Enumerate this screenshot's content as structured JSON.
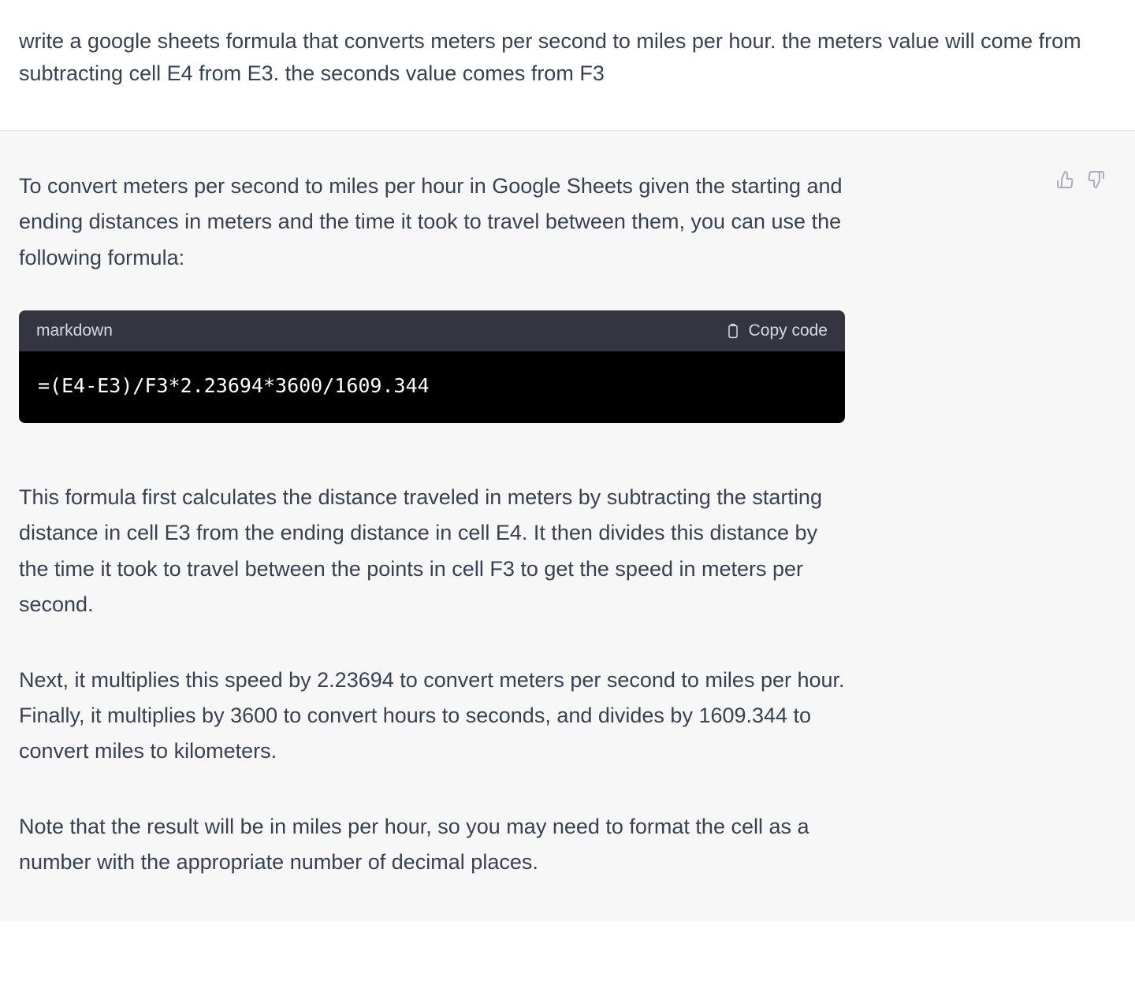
{
  "user": {
    "prompt": "write a google sheets formula that converts meters per second to miles per hour. the meters value will come from subtracting cell E4 from E3. the seconds value comes from F3"
  },
  "assistant": {
    "intro": "To convert meters per second to miles per hour in Google Sheets given the starting and ending distances in meters and the time it took to travel between them, you can use the following formula:",
    "code": {
      "language": "markdown",
      "copy_label": "Copy code",
      "content": "=(E4-E3)/F3*2.23694*3600/1609.344"
    },
    "body1": "This formula first calculates the distance traveled in meters by subtracting the starting distance in cell E3 from the ending distance in cell E4. It then divides this distance by the time it took to travel between the points in cell F3 to get the speed in meters per second.",
    "body2": "Next, it multiplies this speed by 2.23694 to convert meters per second to miles per hour. Finally, it multiplies by 3600 to convert hours to seconds, and divides by 1609.344 to convert miles to kilometers.",
    "body3": "Note that the result will be in miles per hour, so you may need to format the cell as a number with the appropriate number of decimal places."
  }
}
